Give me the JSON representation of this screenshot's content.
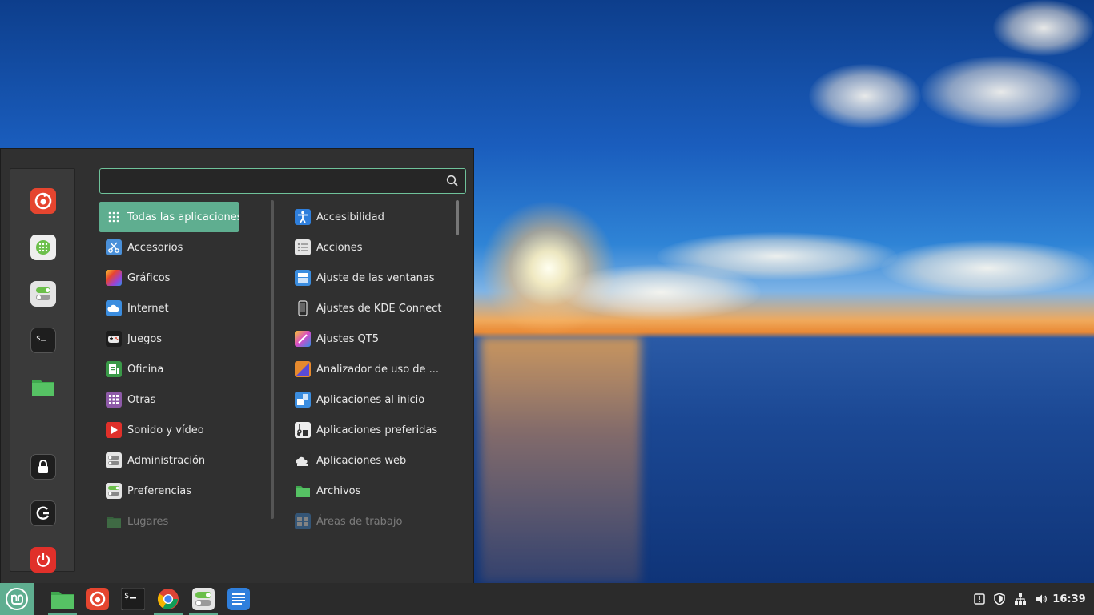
{
  "search": {
    "placeholder": "",
    "value": ""
  },
  "favorites": [
    {
      "name": "firefox",
      "icon": "firefox-icon"
    },
    {
      "name": "software-manager",
      "icon": "software-manager-icon"
    },
    {
      "name": "settings",
      "icon": "settings-toggle-icon"
    },
    {
      "name": "terminal",
      "icon": "terminal-icon"
    },
    {
      "name": "files",
      "icon": "folder-icon"
    },
    {
      "name": "lock-screen",
      "icon": "lock-icon"
    },
    {
      "name": "logout",
      "icon": "logout-icon"
    },
    {
      "name": "shutdown",
      "icon": "power-icon"
    }
  ],
  "categories": [
    {
      "label": "Todas las aplicaciones",
      "icon": "grid-icon",
      "selected": true
    },
    {
      "label": "Accesorios",
      "icon": "scissors-icon"
    },
    {
      "label": "Gráficos",
      "icon": "graphics-icon"
    },
    {
      "label": "Internet",
      "icon": "cloud-icon"
    },
    {
      "label": "Juegos",
      "icon": "gamepad-icon"
    },
    {
      "label": "Oficina",
      "icon": "office-icon"
    },
    {
      "label": "Otras",
      "icon": "apps-grid-icon"
    },
    {
      "label": "Sonido y vídeo",
      "icon": "play-icon"
    },
    {
      "label": "Administración",
      "icon": "admin-toggle-icon"
    },
    {
      "label": "Preferencias",
      "icon": "preferences-toggle-icon"
    },
    {
      "label": "Lugares",
      "icon": "folder-icon",
      "faded": true
    }
  ],
  "apps": [
    {
      "label": "Accesibilidad",
      "icon": "accessibility-icon"
    },
    {
      "label": "Acciones",
      "icon": "list-icon"
    },
    {
      "label": "Ajuste de las ventanas",
      "icon": "window-icon"
    },
    {
      "label": "Ajustes de KDE Connect",
      "icon": "phone-icon"
    },
    {
      "label": "Ajustes QT5",
      "icon": "brush-icon"
    },
    {
      "label": "Analizador de uso de ...",
      "icon": "disk-usage-icon"
    },
    {
      "label": "Aplicaciones al inicio",
      "icon": "startup-icon"
    },
    {
      "label": "Aplicaciones preferidas",
      "icon": "preferred-apps-icon"
    },
    {
      "label": "Aplicaciones web",
      "icon": "web-apps-icon"
    },
    {
      "label": "Archivos",
      "icon": "folder-icon"
    },
    {
      "label": "Áreas de trabajo",
      "icon": "workspaces-icon",
      "faded": true
    }
  ],
  "taskbar": {
    "menu_icon": "linux-mint-icon",
    "launchers": [
      "folder-icon",
      "firefox-icon",
      "terminal-icon",
      "chrome-icon",
      "settings-toggle-icon",
      "text-editor-icon"
    ]
  },
  "tray": {
    "icons": [
      "update-icon",
      "shield-icon",
      "network-icon",
      "volume-icon"
    ],
    "clock": "16:39"
  },
  "colors": {
    "accent": "#5fae90",
    "panel": "#303030",
    "taskbar": "#2b2b2b"
  }
}
